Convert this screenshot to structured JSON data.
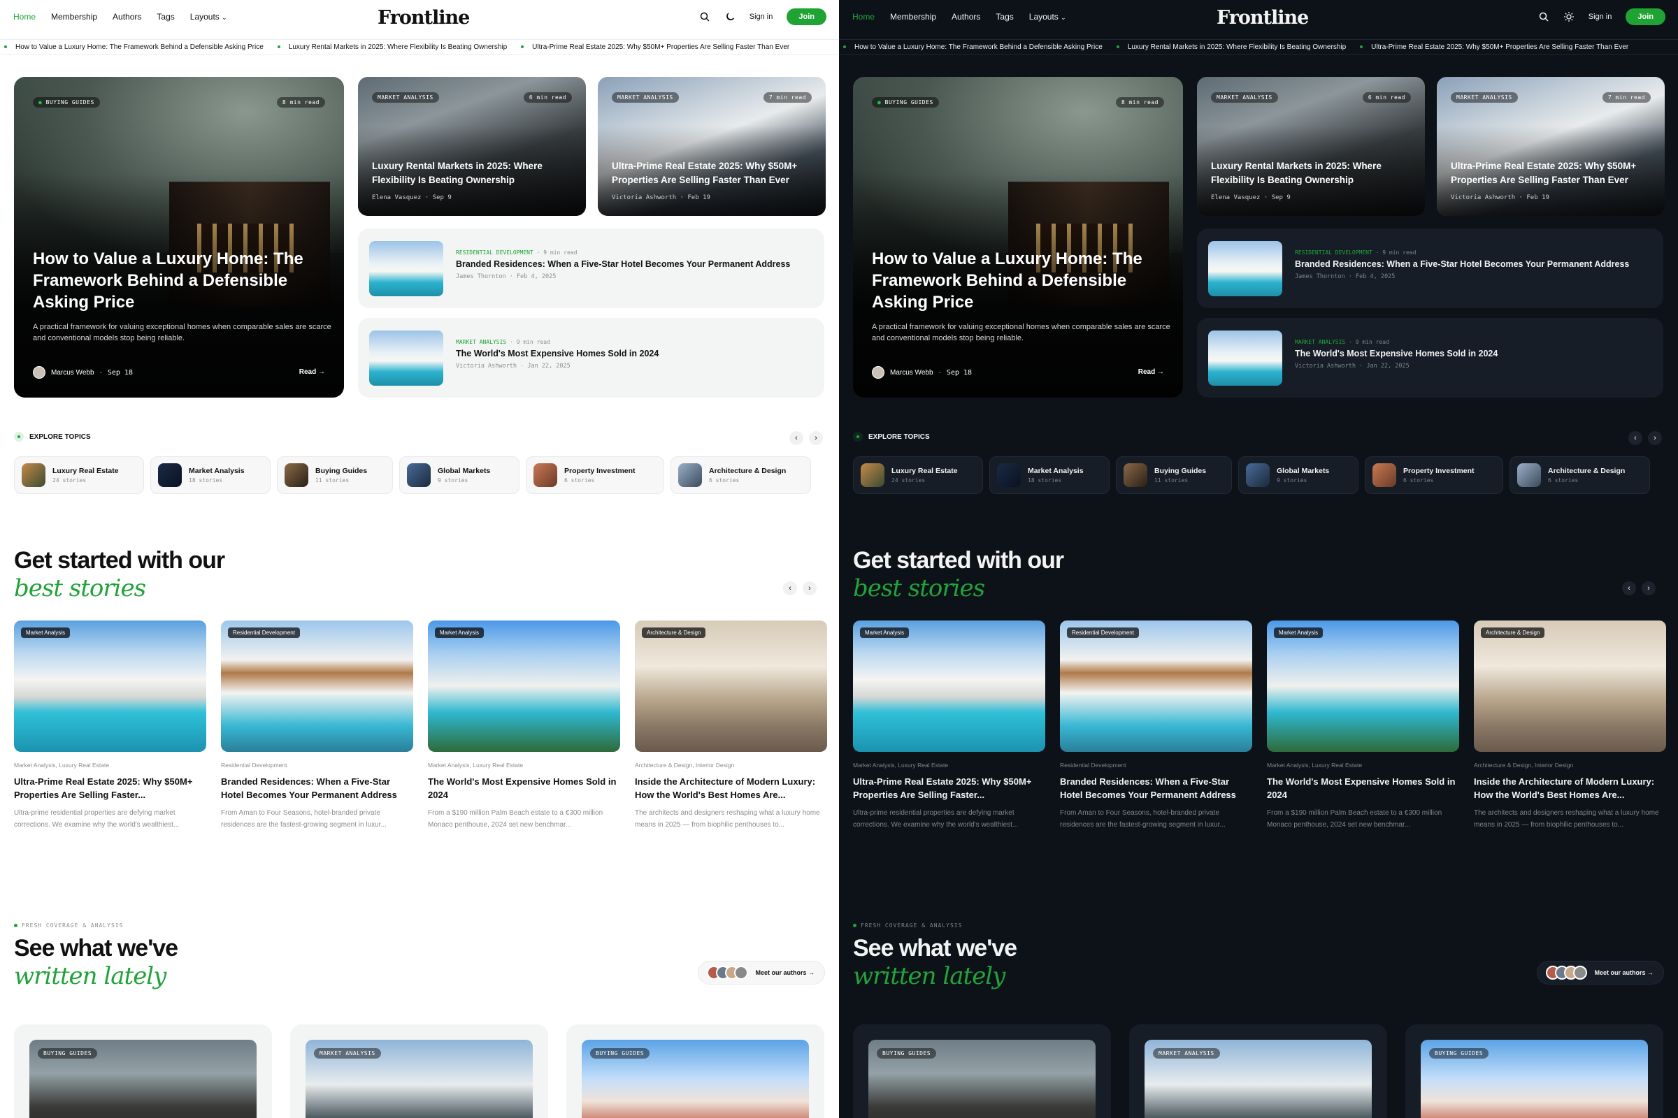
{
  "brand": {
    "logo": "Frontline",
    "accent": "#21a33a"
  },
  "nav": {
    "home": "Home",
    "membership": "Membership",
    "authors": "Authors",
    "tags": "Tags",
    "layouts": "Layouts"
  },
  "header": {
    "signin": "Sign in",
    "join": "Join",
    "icons": [
      "search-icon",
      "theme-toggle-icon"
    ]
  },
  "ticker": [
    "How to Value a Luxury Home: The Framework Behind a Defensible Asking Price",
    "Luxury Rental Markets in 2025: Where Flexibility Is Beating Ownership",
    "Ultra-Prime Real Estate 2025: Why $50M+ Properties Are Selling Faster Than Ever"
  ],
  "hero": {
    "category": "BUYING GUIDES",
    "read_time": "8 min read",
    "title": "How to Value a Luxury Home: The Framework Behind a Defensible Asking Price",
    "excerpt": "A practical framework for valuing exceptional homes when comparable sales are scarce and conventional models stop being reliable.",
    "author": "Marcus Webb",
    "date": "Sep 18",
    "read": "Read →"
  },
  "image_cards": [
    {
      "category": "MARKET ANALYSIS",
      "read_time": "6 min read",
      "title": "Luxury Rental Markets in 2025: Where Flexibility Is Beating Ownership",
      "author": "Elena Vasquez",
      "date": "Sep 9"
    },
    {
      "category": "MARKET ANALYSIS",
      "read_time": "7 min read",
      "title": "Ultra-Prime Real Estate 2025: Why $50M+ Properties Are Selling Faster Than Ever",
      "author": "Victoria Ashworth",
      "date": "Feb 19"
    }
  ],
  "list_cards": [
    {
      "category": "RESIDENTIAL DEVELOPMENT",
      "read_time": "9 min read",
      "title": "Branded Residences: When a Five-Star Hotel Becomes Your Permanent Address",
      "author": "James Thornton",
      "date": "Feb 4, 2025"
    },
    {
      "category": "MARKET ANALYSIS",
      "read_time": "9 min read",
      "title": "The World's Most Expensive Homes Sold in 2024",
      "author": "Victoria Ashworth",
      "date": "Jan 22, 2025"
    }
  ],
  "explore": {
    "label": "EXPLORE TOPICS",
    "topics": [
      {
        "name": "Luxury Real Estate",
        "count": "24 stories"
      },
      {
        "name": "Market Analysis",
        "count": "18 stories"
      },
      {
        "name": "Buying Guides",
        "count": "11 stories"
      },
      {
        "name": "Global Markets",
        "count": "9 stories"
      },
      {
        "name": "Property Investment",
        "count": "6 stories"
      },
      {
        "name": "Architecture & Design",
        "count": "6 stories"
      }
    ]
  },
  "best": {
    "line1": "Get started with our",
    "line2": "best stories",
    "stories": [
      {
        "tag": "Market Analysis",
        "cats": "Market Analysis,  Luxury Real Estate",
        "title": "Ultra-Prime Real Estate 2025: Why $50M+ Properties Are Selling Faster...",
        "excerpt": "Ultra-prime residential properties are defying market corrections. We examine why the world's wealthiest..."
      },
      {
        "tag": "Residential Development",
        "cats": "Residential Development",
        "title": "Branded Residences: When a Five-Star Hotel Becomes Your Permanent Address",
        "excerpt": "From Aman to Four Seasons, hotel-branded private residences are the fastest-growing segment in luxur..."
      },
      {
        "tag": "Market Analysis",
        "cats": "Market Analysis,  Luxury Real Estate",
        "title": "The World's Most Expensive Homes Sold in 2024",
        "excerpt": "From a $190 million Palm Beach estate to a €300 million Monaco penthouse, 2024 set new benchmar..."
      },
      {
        "tag": "Architecture & Design",
        "cats": "Architecture & Design,  Interior Design",
        "title": "Inside the Architecture of Modern Luxury: How the World's Best Homes Are...",
        "excerpt": "The architects and designers reshaping what a luxury home means in 2025 — from biophilic penthouses to..."
      }
    ]
  },
  "latest": {
    "eyebrow": "FRESH COVERAGE & ANALYSIS",
    "line1": "See what we've",
    "line2": "written lately",
    "meet": "Meet our authors →",
    "cards": [
      {
        "category": "BUYING GUIDES"
      },
      {
        "category": "MARKET ANALYSIS"
      },
      {
        "category": "BUYING GUIDES"
      }
    ]
  }
}
